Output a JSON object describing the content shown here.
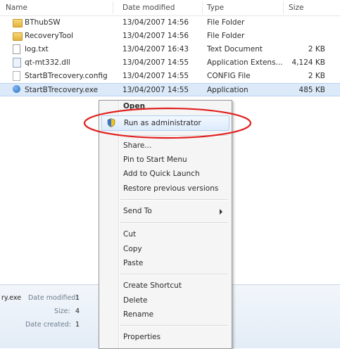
{
  "columns": {
    "name": "Name",
    "date": "Date modified",
    "type": "Type",
    "size": "Size"
  },
  "files": [
    {
      "name": "BThubSW",
      "date": "13/04/2007 14:56",
      "type": "File Folder",
      "size": "",
      "icon": "folder-icon"
    },
    {
      "name": "RecoveryTool",
      "date": "13/04/2007 14:56",
      "type": "File Folder",
      "size": "",
      "icon": "folder-icon"
    },
    {
      "name": "log.txt",
      "date": "13/04/2007 16:43",
      "type": "Text Document",
      "size": "2 KB",
      "icon": "text-file-icon"
    },
    {
      "name": "qt-mt332.dll",
      "date": "13/04/2007 14:55",
      "type": "Application Extens...",
      "size": "4,124 KB",
      "icon": "dll-file-icon"
    },
    {
      "name": "StartBTrecovery.config",
      "date": "13/04/2007 14:55",
      "type": "CONFIG File",
      "size": "2 KB",
      "icon": "config-file-icon"
    },
    {
      "name": "StartBTrecovery.exe",
      "date": "13/04/2007 14:55",
      "type": "Application",
      "size": "485 KB",
      "icon": "application-icon",
      "selected": true
    }
  ],
  "details": {
    "filename_fragment": "ry.exe",
    "date_modified_label": "Date modified:",
    "date_modified_value": "1",
    "size_label": "Size:",
    "size_value": "4",
    "date_created_label": "Date created:",
    "date_created_value": "1"
  },
  "context_menu": {
    "open": "Open",
    "run_as_admin": "Run as administrator",
    "share": "Share...",
    "pin_start": "Pin to Start Menu",
    "quick_launch": "Add to Quick Launch",
    "restore": "Restore previous versions",
    "send_to": "Send To",
    "cut": "Cut",
    "copy": "Copy",
    "paste": "Paste",
    "create_shortcut": "Create Shortcut",
    "delete": "Delete",
    "rename": "Rename",
    "properties": "Properties"
  },
  "colors": {
    "annotation": "#e02020",
    "selection": "#dbe9f9",
    "menu_highlight": "#dcebfc"
  }
}
